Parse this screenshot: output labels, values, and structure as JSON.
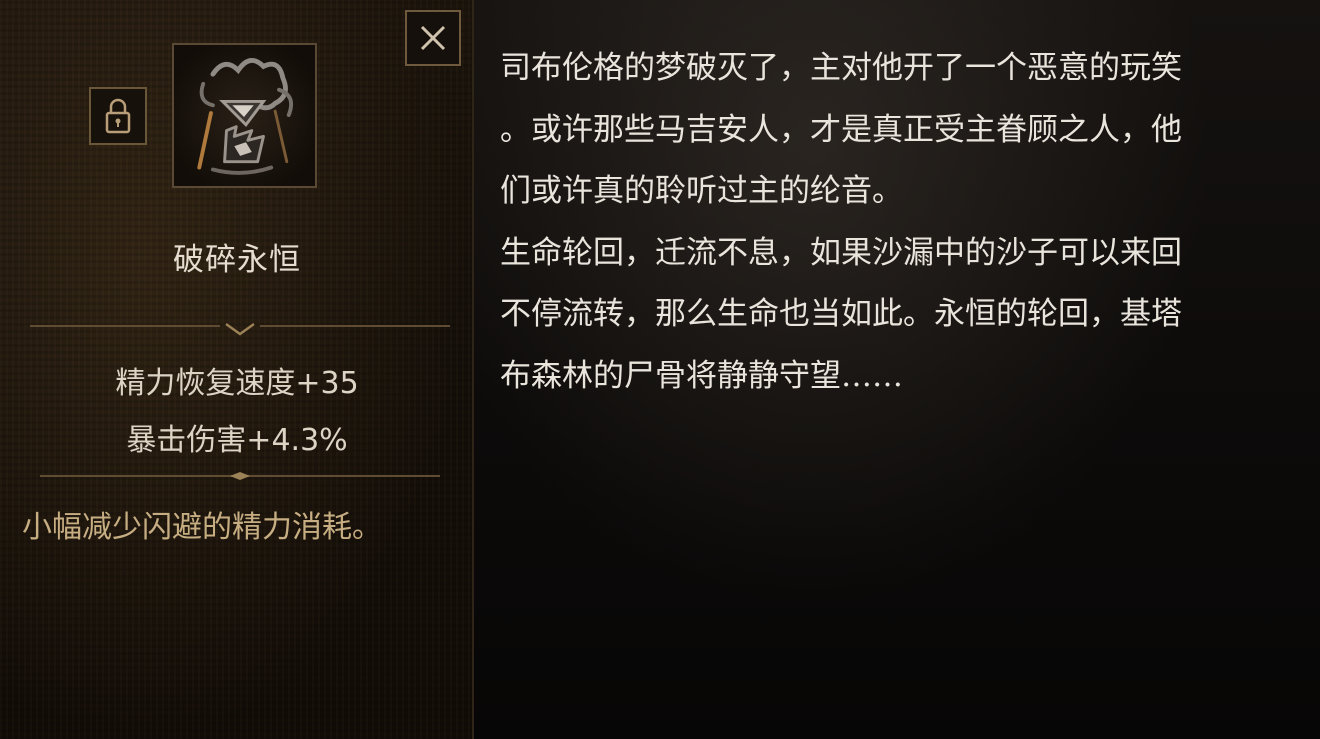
{
  "item": {
    "name": "破碎永恒",
    "image_icon": "broken-hourglass-icon",
    "stats": [
      "精力恢复速度+35",
      "暴击伤害+4.3%"
    ],
    "effect": "小幅减少闪避的精力消耗。"
  },
  "controls": {
    "close_icon": "close-icon",
    "lock_icon": "lock-icon"
  },
  "lore": {
    "paragraph1_lines": [
      "司布伦格的梦破灭了，主对他开了一个恶意的玩笑",
      "。或许那些马吉安人，才是真正受主眷顾之人，他",
      "们或许真的聆听过主的纶音。"
    ],
    "paragraph2_lines": [
      "生命轮回，迁流不息，如果沙漏中的沙子可以来回",
      "不停流转，那么生命也当如此。永恒的轮回，基塔",
      "布森林的尸骨将静静守望……"
    ]
  },
  "colors": {
    "name_text": "#e6ddd0",
    "effect_text": "#c7ae82",
    "lore_text": "#e9e4dc",
    "frame_gold": "#6f5a3e"
  }
}
